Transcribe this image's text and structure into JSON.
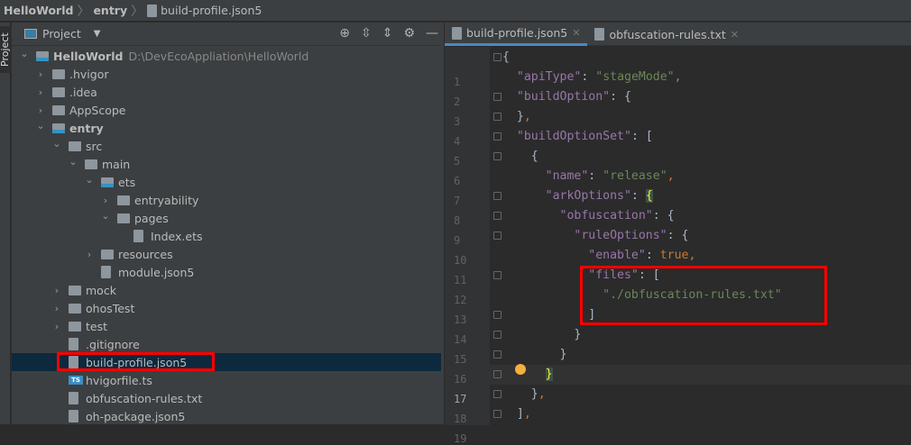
{
  "breadcrumb": [
    "HelloWorld",
    "entry",
    "build-profile.json5"
  ],
  "sidebar_strip_label": "Project",
  "project": {
    "view_label": "Project",
    "tools": [
      "locate-icon",
      "expand-all-icon",
      "collapse-all-icon",
      "gear-icon",
      "minimize-icon"
    ],
    "tree": [
      {
        "name": "HelloWorld",
        "path": "D:\\DevEcoAppliation\\HelloWorld",
        "level": 0,
        "type": "module",
        "expanded": true,
        "bold": true
      },
      {
        "name": ".hvigor",
        "level": 1,
        "type": "folder",
        "expanded": false
      },
      {
        "name": ".idea",
        "level": 1,
        "type": "folder",
        "expanded": false
      },
      {
        "name": "AppScope",
        "level": 1,
        "type": "folder",
        "expanded": false
      },
      {
        "name": "entry",
        "level": 1,
        "type": "module",
        "expanded": true,
        "bold": true
      },
      {
        "name": "src",
        "level": 2,
        "type": "folder",
        "expanded": true
      },
      {
        "name": "main",
        "level": 3,
        "type": "folder",
        "expanded": true
      },
      {
        "name": "ets",
        "level": 4,
        "type": "source-folder",
        "expanded": true
      },
      {
        "name": "entryability",
        "level": 5,
        "type": "folder",
        "expanded": false
      },
      {
        "name": "pages",
        "level": 5,
        "type": "folder",
        "expanded": true
      },
      {
        "name": "Index.ets",
        "level": 6,
        "type": "ets-file"
      },
      {
        "name": "resources",
        "level": 4,
        "type": "folder",
        "expanded": false
      },
      {
        "name": "module.json5",
        "level": 4,
        "type": "json-file"
      },
      {
        "name": "mock",
        "level": 2,
        "type": "folder",
        "expanded": false
      },
      {
        "name": "ohosTest",
        "level": 2,
        "type": "folder",
        "expanded": false
      },
      {
        "name": "test",
        "level": 2,
        "type": "folder",
        "expanded": false
      },
      {
        "name": ".gitignore",
        "level": 2,
        "type": "ignore-file"
      },
      {
        "name": "build-profile.json5",
        "level": 2,
        "type": "json-file",
        "selected": true
      },
      {
        "name": "hvigorfile.ts",
        "level": 2,
        "type": "ts-file"
      },
      {
        "name": "obfuscation-rules.txt",
        "level": 2,
        "type": "text-file"
      },
      {
        "name": "oh-package.json5",
        "level": 2,
        "type": "json-file"
      }
    ]
  },
  "editor": {
    "tabs": [
      {
        "label": "build-profile.json5",
        "active": true
      },
      {
        "label": "obfuscation-rules.txt",
        "active": false
      }
    ],
    "current_line": 17,
    "lines": [
      [
        0,
        [
          [
            "{",
            "p"
          ]
        ]
      ],
      [
        2,
        [
          [
            "\"apiType\"",
            "k"
          ],
          [
            ": ",
            "p"
          ],
          [
            "\"stageMode\"",
            "s"
          ],
          [
            ",",
            "c"
          ]
        ]
      ],
      [
        2,
        [
          [
            "\"buildOption\"",
            "k"
          ],
          [
            ": {",
            "p"
          ]
        ]
      ],
      [
        2,
        [
          [
            "}",
            "p"
          ],
          [
            ",",
            "c"
          ]
        ]
      ],
      [
        2,
        [
          [
            "\"buildOptionSet\"",
            "k"
          ],
          [
            ": [",
            "p"
          ]
        ]
      ],
      [
        4,
        [
          [
            "{",
            "p"
          ]
        ]
      ],
      [
        6,
        [
          [
            "\"name\"",
            "k"
          ],
          [
            ": ",
            "p"
          ],
          [
            "\"release\"",
            "s"
          ],
          [
            ",",
            "c"
          ]
        ]
      ],
      [
        6,
        [
          [
            "\"arkOptions\"",
            "k"
          ],
          [
            ": ",
            "p"
          ],
          [
            "{",
            "hl"
          ]
        ]
      ],
      [
        8,
        [
          [
            "\"obfuscation\"",
            "k"
          ],
          [
            ": {",
            "p"
          ]
        ]
      ],
      [
        10,
        [
          [
            "\"ruleOptions\"",
            "k"
          ],
          [
            ": {",
            "p"
          ]
        ]
      ],
      [
        12,
        [
          [
            "\"enable\"",
            "k"
          ],
          [
            ": ",
            "p"
          ],
          [
            "true",
            "c"
          ],
          [
            ",",
            "c"
          ]
        ]
      ],
      [
        12,
        [
          [
            "\"files\"",
            "k"
          ],
          [
            ": [",
            "p"
          ]
        ]
      ],
      [
        14,
        [
          [
            "\"./obfuscation-rules.txt\"",
            "s"
          ]
        ]
      ],
      [
        12,
        [
          [
            "]",
            "p"
          ]
        ]
      ],
      [
        10,
        [
          [
            "}",
            "p"
          ]
        ]
      ],
      [
        8,
        [
          [
            "}",
            "p"
          ]
        ]
      ],
      [
        6,
        [
          [
            "}",
            "hl"
          ]
        ]
      ],
      [
        4,
        [
          [
            "}",
            "p"
          ],
          [
            ",",
            "c"
          ]
        ]
      ],
      [
        2,
        [
          [
            "]",
            "p"
          ],
          [
            ",",
            "c"
          ]
        ]
      ]
    ]
  },
  "colors": {
    "highlight_box": "#ff0000",
    "selection": "#0d293e",
    "accent": "#4a88c7"
  }
}
